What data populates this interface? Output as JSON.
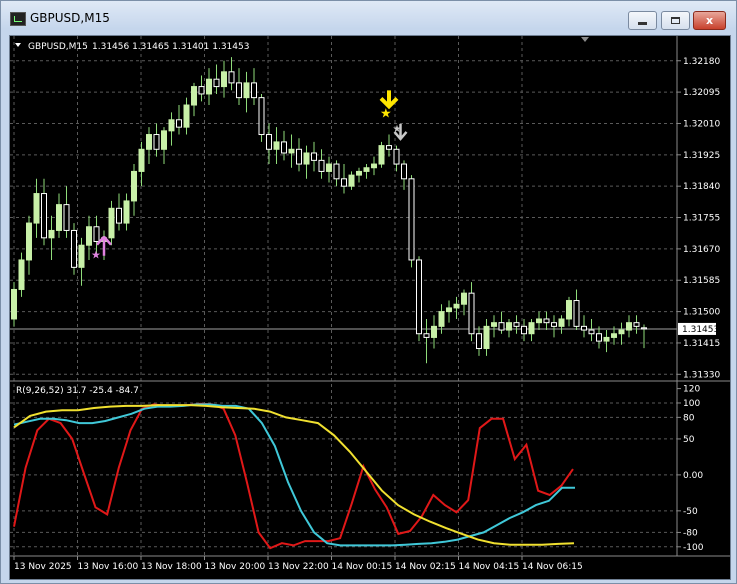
{
  "window": {
    "title": "GBPUSD,M15",
    "minimize_label": "",
    "maximize_label": "",
    "close_label": "x"
  },
  "colors": {
    "background": "#000000",
    "grid": "#5a5a5a",
    "bull_candle": "#c8f0a8",
    "bear_candle": "#ffffff",
    "wick": "#8fdc7a",
    "price_line": "#a0a0a0",
    "buy_arrow": "#e082e0",
    "sell_arrow_yellow": "#ffe600",
    "sell_arrow_gray": "#c8c8c8",
    "rsi_red": "#e01818",
    "rsi_yellow": "#f0e030",
    "rsi_cyan": "#40c8d8"
  },
  "main_panel": {
    "symbol_label": "GBPUSD,M15",
    "ohlc_text": "1.31456 1.31465 1.31401 1.31453",
    "price_ticks": [
      "1.32180",
      "1.32095",
      "1.32010",
      "1.31925",
      "1.31840",
      "1.31755",
      "1.31670",
      "1.31585",
      "1.31500",
      "1.31415",
      "1.31330"
    ],
    "current_price": "1.31453",
    "icons": {
      "dropdown": "triangle-down-icon",
      "scroll_marker": "shift-marker-icon"
    }
  },
  "indicator_panel": {
    "label": "R(9,26,52) 31.7 -25.4 -84.7",
    "level_ticks": [
      "120",
      "100",
      "80",
      "50",
      "0.00",
      "-50",
      "-80",
      "-100"
    ]
  },
  "time_axis": [
    "13 Nov 2025",
    "13 Nov 16:00",
    "13 Nov 18:00",
    "13 Nov 20:00",
    "13 Nov 22:00",
    "14 Nov 00:15",
    "14 Nov 02:15",
    "14 Nov 04:15",
    "14 Nov 06:15"
  ],
  "chart_data": [
    {
      "type": "candlestick",
      "title": "GBPUSD,M15",
      "ylim": [
        1.3132,
        1.3222
      ],
      "grid": true,
      "candles": [
        {
          "o": 1.3148,
          "h": 1.3158,
          "l": 1.3146,
          "c": 1.3156
        },
        {
          "o": 1.3156,
          "h": 1.3166,
          "l": 1.3154,
          "c": 1.3164
        },
        {
          "o": 1.3164,
          "h": 1.3176,
          "l": 1.316,
          "c": 1.3174
        },
        {
          "o": 1.3174,
          "h": 1.3186,
          "l": 1.317,
          "c": 1.3182
        },
        {
          "o": 1.3182,
          "h": 1.3186,
          "l": 1.3168,
          "c": 1.317
        },
        {
          "o": 1.317,
          "h": 1.3176,
          "l": 1.3164,
          "c": 1.3172
        },
        {
          "o": 1.3172,
          "h": 1.3182,
          "l": 1.317,
          "c": 1.3179
        },
        {
          "o": 1.3179,
          "h": 1.3184,
          "l": 1.317,
          "c": 1.3172
        },
        {
          "o": 1.3172,
          "h": 1.3174,
          "l": 1.316,
          "c": 1.3162
        },
        {
          "o": 1.3162,
          "h": 1.317,
          "l": 1.3157,
          "c": 1.3168
        },
        {
          "o": 1.3168,
          "h": 1.3176,
          "l": 1.3164,
          "c": 1.3173
        },
        {
          "o": 1.3173,
          "h": 1.3176,
          "l": 1.3165,
          "c": 1.3169
        },
        {
          "o": 1.3169,
          "h": 1.3172,
          "l": 1.3164,
          "c": 1.317
        },
        {
          "o": 1.317,
          "h": 1.318,
          "l": 1.3168,
          "c": 1.3178
        },
        {
          "o": 1.3178,
          "h": 1.3182,
          "l": 1.3172,
          "c": 1.3174
        },
        {
          "o": 1.3174,
          "h": 1.3182,
          "l": 1.3172,
          "c": 1.318
        },
        {
          "o": 1.318,
          "h": 1.319,
          "l": 1.3176,
          "c": 1.3188
        },
        {
          "o": 1.3188,
          "h": 1.3196,
          "l": 1.3184,
          "c": 1.3194
        },
        {
          "o": 1.3194,
          "h": 1.32,
          "l": 1.319,
          "c": 1.3198
        },
        {
          "o": 1.3198,
          "h": 1.3201,
          "l": 1.3192,
          "c": 1.3194
        },
        {
          "o": 1.3194,
          "h": 1.32,
          "l": 1.319,
          "c": 1.3199
        },
        {
          "o": 1.3199,
          "h": 1.3204,
          "l": 1.3195,
          "c": 1.3202
        },
        {
          "o": 1.3202,
          "h": 1.3206,
          "l": 1.3198,
          "c": 1.32
        },
        {
          "o": 1.32,
          "h": 1.3208,
          "l": 1.3198,
          "c": 1.3206
        },
        {
          "o": 1.3206,
          "h": 1.3212,
          "l": 1.3203,
          "c": 1.3211
        },
        {
          "o": 1.3211,
          "h": 1.3214,
          "l": 1.3207,
          "c": 1.3209
        },
        {
          "o": 1.3209,
          "h": 1.3216,
          "l": 1.3206,
          "c": 1.3213
        },
        {
          "o": 1.3213,
          "h": 1.3217,
          "l": 1.3209,
          "c": 1.3211
        },
        {
          "o": 1.3211,
          "h": 1.3218,
          "l": 1.3208,
          "c": 1.3215
        },
        {
          "o": 1.3215,
          "h": 1.3219,
          "l": 1.321,
          "c": 1.3212
        },
        {
          "o": 1.3212,
          "h": 1.3216,
          "l": 1.3206,
          "c": 1.3208
        },
        {
          "o": 1.3208,
          "h": 1.3215,
          "l": 1.3204,
          "c": 1.3212
        },
        {
          "o": 1.3212,
          "h": 1.3216,
          "l": 1.3206,
          "c": 1.3208
        },
        {
          "o": 1.3208,
          "h": 1.3209,
          "l": 1.3196,
          "c": 1.3198
        },
        {
          "o": 1.3198,
          "h": 1.3201,
          "l": 1.319,
          "c": 1.3194
        },
        {
          "o": 1.3194,
          "h": 1.32,
          "l": 1.319,
          "c": 1.3196
        },
        {
          "o": 1.3196,
          "h": 1.3199,
          "l": 1.3191,
          "c": 1.3193
        },
        {
          "o": 1.3193,
          "h": 1.3198,
          "l": 1.3189,
          "c": 1.3194
        },
        {
          "o": 1.3194,
          "h": 1.3197,
          "l": 1.3188,
          "c": 1.319
        },
        {
          "o": 1.319,
          "h": 1.3195,
          "l": 1.3186,
          "c": 1.3193
        },
        {
          "o": 1.3193,
          "h": 1.3196,
          "l": 1.3188,
          "c": 1.3191
        },
        {
          "o": 1.3191,
          "h": 1.3194,
          "l": 1.3186,
          "c": 1.3188
        },
        {
          "o": 1.3188,
          "h": 1.3192,
          "l": 1.3185,
          "c": 1.319
        },
        {
          "o": 1.319,
          "h": 1.3191,
          "l": 1.3184,
          "c": 1.3186
        },
        {
          "o": 1.3186,
          "h": 1.319,
          "l": 1.3182,
          "c": 1.3184
        },
        {
          "o": 1.3184,
          "h": 1.3188,
          "l": 1.3183,
          "c": 1.3187
        },
        {
          "o": 1.3187,
          "h": 1.3189,
          "l": 1.3185,
          "c": 1.3188
        },
        {
          "o": 1.3188,
          "h": 1.319,
          "l": 1.3186,
          "c": 1.3189
        },
        {
          "o": 1.3189,
          "h": 1.3192,
          "l": 1.3187,
          "c": 1.319
        },
        {
          "o": 1.319,
          "h": 1.3196,
          "l": 1.3189,
          "c": 1.3195
        },
        {
          "o": 1.3195,
          "h": 1.3198,
          "l": 1.3192,
          "c": 1.3194
        },
        {
          "o": 1.3194,
          "h": 1.3195,
          "l": 1.3188,
          "c": 1.319
        },
        {
          "o": 1.319,
          "h": 1.3191,
          "l": 1.3183,
          "c": 1.3186
        },
        {
          "o": 1.3186,
          "h": 1.3187,
          "l": 1.3162,
          "c": 1.3164
        },
        {
          "o": 1.3164,
          "h": 1.3165,
          "l": 1.3142,
          "c": 1.3144
        },
        {
          "o": 1.3144,
          "h": 1.3148,
          "l": 1.3136,
          "c": 1.3143
        },
        {
          "o": 1.3143,
          "h": 1.3149,
          "l": 1.314,
          "c": 1.3146
        },
        {
          "o": 1.3146,
          "h": 1.3152,
          "l": 1.3144,
          "c": 1.315
        },
        {
          "o": 1.315,
          "h": 1.3153,
          "l": 1.3147,
          "c": 1.3151
        },
        {
          "o": 1.3151,
          "h": 1.3154,
          "l": 1.3148,
          "c": 1.3152
        },
        {
          "o": 1.3152,
          "h": 1.3156,
          "l": 1.3149,
          "c": 1.3155
        },
        {
          "o": 1.3155,
          "h": 1.3158,
          "l": 1.3142,
          "c": 1.3144
        },
        {
          "o": 1.3144,
          "h": 1.3146,
          "l": 1.3138,
          "c": 1.314
        },
        {
          "o": 1.314,
          "h": 1.3148,
          "l": 1.3138,
          "c": 1.3146
        },
        {
          "o": 1.3146,
          "h": 1.3149,
          "l": 1.3143,
          "c": 1.3147
        },
        {
          "o": 1.3147,
          "h": 1.315,
          "l": 1.3144,
          "c": 1.3145
        },
        {
          "o": 1.3145,
          "h": 1.3148,
          "l": 1.3143,
          "c": 1.3147
        },
        {
          "o": 1.3147,
          "h": 1.3149,
          "l": 1.3144,
          "c": 1.3146
        },
        {
          "o": 1.3146,
          "h": 1.3148,
          "l": 1.3142,
          "c": 1.3144
        },
        {
          "o": 1.3144,
          "h": 1.3148,
          "l": 1.3142,
          "c": 1.3147
        },
        {
          "o": 1.3147,
          "h": 1.315,
          "l": 1.3145,
          "c": 1.3148
        },
        {
          "o": 1.3148,
          "h": 1.315,
          "l": 1.3145,
          "c": 1.3147
        },
        {
          "o": 1.3147,
          "h": 1.3149,
          "l": 1.3143,
          "c": 1.3146
        },
        {
          "o": 1.3146,
          "h": 1.3149,
          "l": 1.3144,
          "c": 1.3148
        },
        {
          "o": 1.3148,
          "h": 1.3154,
          "l": 1.3146,
          "c": 1.3153
        },
        {
          "o": 1.3153,
          "h": 1.3156,
          "l": 1.3145,
          "c": 1.3146
        },
        {
          "o": 1.3146,
          "h": 1.3149,
          "l": 1.3143,
          "c": 1.3145
        },
        {
          "o": 1.3145,
          "h": 1.3148,
          "l": 1.3142,
          "c": 1.3144
        },
        {
          "o": 1.3144,
          "h": 1.3146,
          "l": 1.314,
          "c": 1.3142
        },
        {
          "o": 1.3142,
          "h": 1.3145,
          "l": 1.3139,
          "c": 1.3143
        },
        {
          "o": 1.3143,
          "h": 1.3146,
          "l": 1.3141,
          "c": 1.3144
        },
        {
          "o": 1.3144,
          "h": 1.3147,
          "l": 1.3141,
          "c": 1.3145
        },
        {
          "o": 1.3145,
          "h": 1.3149,
          "l": 1.3143,
          "c": 1.3147
        },
        {
          "o": 1.3147,
          "h": 1.3149,
          "l": 1.3144,
          "c": 1.3146
        },
        {
          "o": 1.31456,
          "h": 1.31465,
          "l": 1.31401,
          "c": 1.31453
        }
      ],
      "signals": [
        {
          "kind": "buy",
          "index": 12,
          "price": 1.31665,
          "color": "#e082e0"
        },
        {
          "kind": "sell",
          "index": 50,
          "price": 1.3204,
          "color": "#ffe600"
        },
        {
          "kind": "sell",
          "index": 51,
          "price": 1.3196,
          "color": "#c8c8c8"
        }
      ]
    },
    {
      "type": "line",
      "title": "R(9,26,52) 31.7 -25.4 -84.7",
      "ylim": [
        -110,
        125
      ],
      "grid": true,
      "levels": [
        120,
        100,
        80,
        50,
        0,
        -50,
        -80,
        -100
      ],
      "series": [
        {
          "name": "R(9)",
          "color": "#e01818",
          "values": [
            -72,
            10,
            62,
            78,
            72,
            50,
            2,
            -45,
            -55,
            10,
            62,
            92,
            98,
            96,
            96,
            97,
            99,
            98,
            92,
            55,
            -10,
            -80,
            -102,
            -95,
            -98,
            -92,
            -92,
            -92,
            -88,
            -40,
            12,
            -20,
            -45,
            -82,
            -78,
            -58,
            -28,
            -42,
            -52,
            -35,
            65,
            78,
            78,
            22,
            42,
            -22,
            -28,
            -15,
            8
          ]
        },
        {
          "name": "R(26)",
          "color": "#40c8d8",
          "values": [
            70,
            74,
            78,
            78,
            76,
            72,
            72,
            75,
            80,
            85,
            92,
            95,
            95,
            96,
            98,
            98,
            96,
            96,
            92,
            72,
            40,
            -10,
            -50,
            -80,
            -95,
            -98,
            -98,
            -98,
            -98,
            -98,
            -97,
            -96,
            -95,
            -93,
            -90,
            -85,
            -80,
            -70,
            -60,
            -52,
            -42,
            -36,
            -18,
            -18
          ]
        },
        {
          "name": "R(52)",
          "color": "#f0e030",
          "values": [
            66,
            82,
            88,
            90,
            90,
            93,
            95,
            96,
            96,
            97,
            97,
            97,
            96,
            94,
            93,
            92,
            88,
            80,
            76,
            72,
            55,
            32,
            5,
            -22,
            -42,
            -55,
            -65,
            -74,
            -82,
            -90,
            -95,
            -97,
            -97,
            -97,
            -96,
            -95
          ]
        }
      ]
    }
  ]
}
